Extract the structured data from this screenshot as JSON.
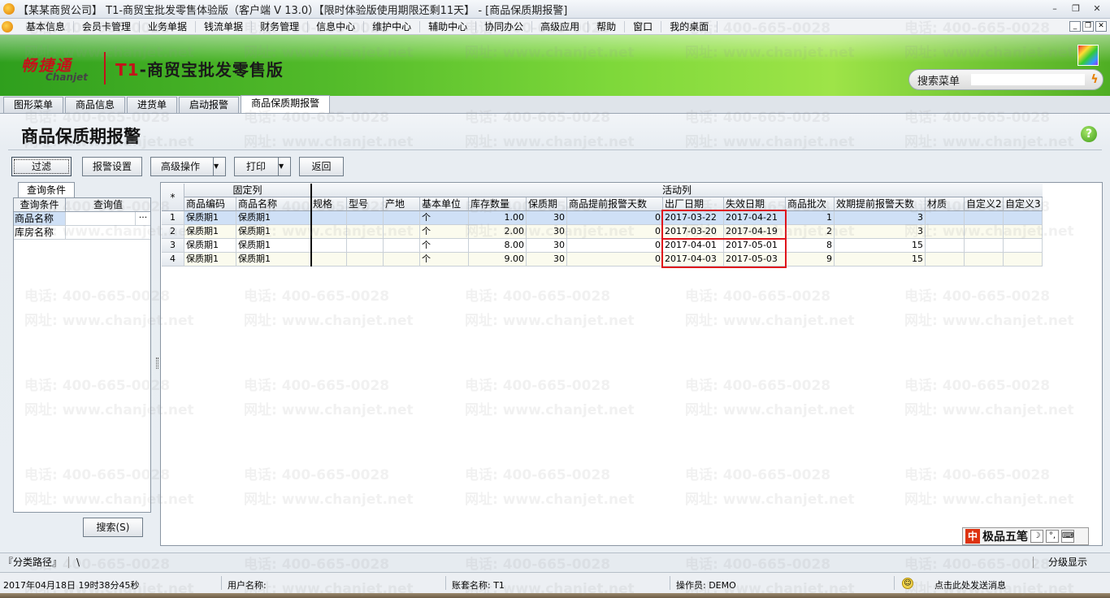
{
  "window": {
    "title": "【某某商贸公司】 T1-商贸宝批发零售体验版（客户端 V 13.0）【限时体验版使用期限还剩11天】 - [商品保质期报警]",
    "controls": [
      "–",
      "❐",
      "✕"
    ]
  },
  "menu": [
    "基本信息",
    "会员卡管理",
    "业务单据",
    "钱流单据",
    "财务管理",
    "信息中心",
    "维护中心",
    "辅助中心",
    "协同办公",
    "高级应用",
    "帮助",
    "窗口",
    "我的桌面"
  ],
  "banner": {
    "brand_cn": "畅捷通",
    "brand_en": "Chanjet",
    "product_prefix": "T1",
    "product_rest": "-商贸宝批发零售版",
    "search_label": "搜索菜单",
    "search_value": ""
  },
  "tabs": [
    "图形菜单",
    "商品信息",
    "进货单",
    "启动报警",
    "商品保质期报警"
  ],
  "page": {
    "title": "商品保质期报警",
    "buttons": {
      "filter": "过滤",
      "alarm_settings": "报警设置",
      "advanced": "高级操作",
      "print": "打印",
      "back": "返回",
      "search": "搜索(S)"
    }
  },
  "query": {
    "tab": "查询条件",
    "headers": [
      "查询条件",
      "查询值"
    ],
    "rows": [
      {
        "name": "商品名称",
        "value": "",
        "more": "···"
      },
      {
        "name": "库房名称",
        "value": ""
      }
    ]
  },
  "grid": {
    "group_fixed": "固定列",
    "group_active": "活动列",
    "corner": "*",
    "headers": [
      "商品编码",
      "商品名称",
      "规格",
      "型号",
      "产地",
      "基本单位",
      "库存数量",
      "保质期",
      "商品提前报警天数",
      "出厂日期",
      "失效日期",
      "商品批次",
      "效期提前报警天数",
      "材质",
      "自定义2",
      "自定义3"
    ],
    "rows": [
      {
        "no": "1",
        "code": "保质期1",
        "name": "保质期1",
        "spec": "",
        "model": "",
        "origin": "",
        "unit": "个",
        "qty": "1.00",
        "shelf": "30",
        "warn_days": "0",
        "mfg": "2017-03-22",
        "exp": "2017-04-21",
        "batch": "1",
        "exp_warn": "3",
        "material": "",
        "c2": "",
        "c3": ""
      },
      {
        "no": "2",
        "code": "保质期1",
        "name": "保质期1",
        "spec": "",
        "model": "",
        "origin": "",
        "unit": "个",
        "qty": "2.00",
        "shelf": "30",
        "warn_days": "0",
        "mfg": "2017-03-20",
        "exp": "2017-04-19",
        "batch": "2",
        "exp_warn": "3",
        "material": "",
        "c2": "",
        "c3": ""
      },
      {
        "no": "3",
        "code": "保质期1",
        "name": "保质期1",
        "spec": "",
        "model": "",
        "origin": "",
        "unit": "个",
        "qty": "8.00",
        "shelf": "30",
        "warn_days": "0",
        "mfg": "2017-04-01",
        "exp": "2017-05-01",
        "batch": "8",
        "exp_warn": "15",
        "material": "",
        "c2": "",
        "c3": ""
      },
      {
        "no": "4",
        "code": "保质期1",
        "name": "保质期1",
        "spec": "",
        "model": "",
        "origin": "",
        "unit": "个",
        "qty": "9.00",
        "shelf": "30",
        "warn_days": "0",
        "mfg": "2017-04-03",
        "exp": "2017-05-03",
        "batch": "9",
        "exp_warn": "15",
        "material": "",
        "c2": "",
        "c3": ""
      }
    ]
  },
  "ime": {
    "logo": "中",
    "name": "极品五笔",
    "icons": [
      "☽",
      "°,",
      "⌨"
    ]
  },
  "pathbar": {
    "label": "『分类路径』",
    "value": "\\",
    "right": "分级显示"
  },
  "status": {
    "datetime": "2017年04月18日  19时38分45秒",
    "user": "用户名称:",
    "account": "账套名称: T1",
    "operator": "操作员: DEMO",
    "message": "点击此处发送消息"
  },
  "watermark": [
    "电话: 400-665-0028",
    "网址: www.chanjet.net"
  ],
  "colors": {
    "highlight_box": "#e0141b",
    "selected_row": "#cfe0f6",
    "banner_green": "#53bb2a"
  }
}
